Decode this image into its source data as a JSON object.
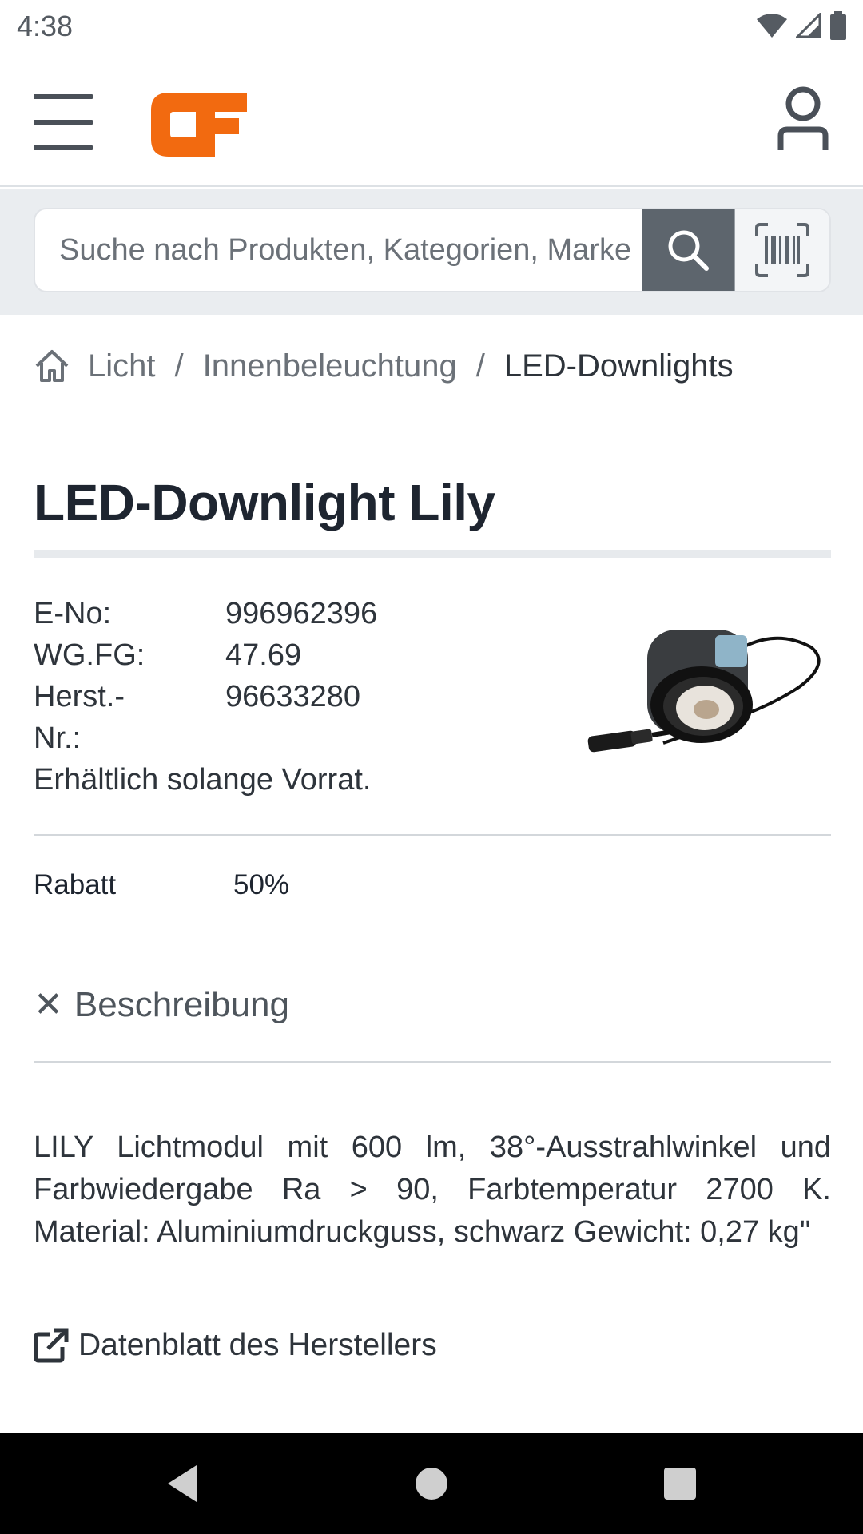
{
  "status_bar": {
    "time": "4:38"
  },
  "header": {
    "logo_text": "CF",
    "brand_color": "#f26a10"
  },
  "search": {
    "placeholder": "Suche nach Produkten, Kategorien, Marke"
  },
  "breadcrumb": {
    "items": [
      "Licht",
      "Innenbeleuchtung",
      "LED-Downlights"
    ],
    "separator": "/"
  },
  "product": {
    "title": "LED-Downlight Lily",
    "specs": [
      {
        "label": "E-No:",
        "value": "996962396"
      },
      {
        "label": "WG.FG:",
        "value": "47.69"
      },
      {
        "label": "Herst.-Nr.:",
        "value": "96633280"
      }
    ],
    "availability": "Erhältlich solange Vorrat.",
    "discount_label": "Rabatt",
    "discount_value": "50%"
  },
  "description": {
    "toggle_icon": "✕",
    "heading": "Beschreibung",
    "text": "LILY Lichtmodul mit 600 lm, 38°-Ausstrahlwinkel und Farbwiedergabe Ra > 90, Farbtemperatur 2700 K. Material: Aluminiumdruckguss, schwarz Gewicht: 0,27 kg\""
  },
  "datasheet_link": "Datenblatt des Herstellers"
}
